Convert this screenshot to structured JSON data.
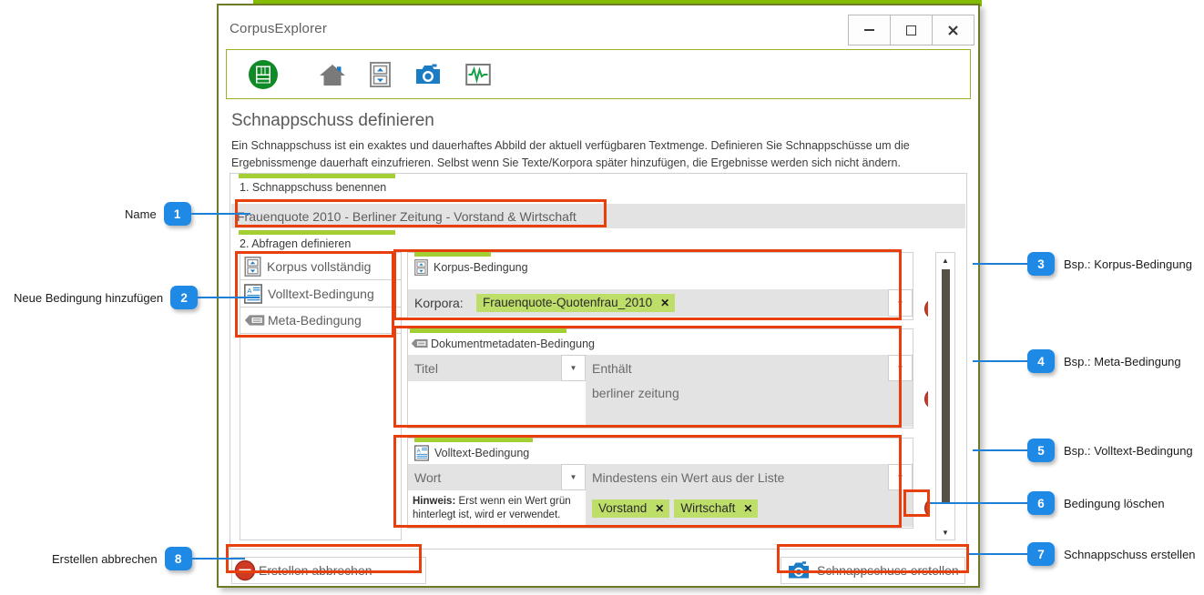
{
  "window": {
    "title": "CorpusExplorer",
    "controls": [
      {
        "name": "minimize",
        "glyph": "–"
      },
      {
        "name": "maximize",
        "glyph": "□"
      },
      {
        "name": "close",
        "glyph": "✕"
      }
    ]
  },
  "toolbar": {
    "icons": [
      {
        "name": "corpusexplorer-logo-icon",
        "label": "CorpusExplorer"
      },
      {
        "name": "home-icon",
        "label": "Start"
      },
      {
        "name": "archive-cabinet-icon",
        "label": "Korpora"
      },
      {
        "name": "camera-snapshot-icon",
        "label": "Schnappschuss"
      },
      {
        "name": "analytics-chart-icon",
        "label": "Analyse"
      }
    ]
  },
  "page": {
    "heading": "Schnappschuss definieren",
    "intro": "Ein Schnappschuss ist ein exaktes und dauerhaftes Abbild der aktuell verfügbaren Textmenge. Definieren Sie Schnappschüsse um die Ergebnissmenge dauerhaft einzufrieren. Selbst wenn Sie Texte/Korpora später hinzufügen, die Ergebnisse werden sich nicht ändern."
  },
  "step1": {
    "label": "1. Schnappschuss benennen",
    "name_value": "Frauenquote 2010 - Berliner Zeitung - Vorstand & Wirtschaft"
  },
  "step2": {
    "label": "2. Abfragen definieren",
    "condition_types": [
      {
        "icon": "archive-cabinet-icon",
        "label": "Korpus vollständig"
      },
      {
        "icon": "fulltext-document-icon",
        "label": "Volltext-Bedingung"
      },
      {
        "icon": "meta-tag-icon",
        "label": "Meta-Bedingung"
      }
    ]
  },
  "panels": [
    {
      "title": "Korpus-Bedingung",
      "icon": "archive-cabinet-icon",
      "field_label": "Korpora:",
      "tags": [
        {
          "text": "Frauenquote-Quotenfrau_2010",
          "remove": "✕"
        }
      ],
      "dropdown_glyph": "▼",
      "remove_glyph": "minus"
    },
    {
      "title": "Dokumentmetadaten-Bedingung",
      "icon": "meta-tag-icon",
      "left_select": "Titel",
      "right_select": "Enthält",
      "value_text": "berliner zeitung",
      "dropdown_glyph": "▼"
    },
    {
      "title": "Volltext-Bedingung",
      "icon": "fulltext-document-icon",
      "left_select": "Wort",
      "right_select": "Mindestens ein Wert aus der Liste",
      "hint_strong": "Hinweis:",
      "hint_text": " Erst wenn ein Wert grün hinterlegt ist, wird er verwendet.",
      "tags": [
        {
          "text": "Vorstand",
          "remove": "✕"
        },
        {
          "text": "Wirtschaft",
          "remove": "✕"
        }
      ],
      "dropdown_glyph": "▼"
    }
  ],
  "scrollbar": {
    "up_glyph": "▲",
    "down_glyph": "▼"
  },
  "actions": {
    "cancel_label": "Erstellen abbrechen",
    "cancel_icon": "cancel-minus-icon",
    "create_label": "Schnappschuss erstellen",
    "create_icon": "camera-snapshot-icon"
  },
  "annotations": [
    {
      "number": "1",
      "text": "Name",
      "side": "left"
    },
    {
      "number": "2",
      "text": "Neue Bedingung hinzufügen",
      "side": "left"
    },
    {
      "number": "3",
      "text": "Bsp.: Korpus-Bedingung",
      "side": "right"
    },
    {
      "number": "4",
      "text": "Bsp.: Meta-Bedingung",
      "side": "right"
    },
    {
      "number": "5",
      "text": "Bsp.: Volltext-Bedingung",
      "side": "right"
    },
    {
      "number": "6",
      "text": "Bedingung löschen",
      "side": "right"
    },
    {
      "number": "7",
      "text": "Schnappschuss erstellen",
      "side": "right"
    },
    {
      "number": "8",
      "text": "Erstellen abbrechen",
      "side": "left"
    }
  ],
  "colors": {
    "accent_green": "#84bd00",
    "section_green": "#a3cf35",
    "tag_green": "#bede6a",
    "highlight_red": "#e8400c",
    "badge_blue": "#1e8ae6",
    "remove_red": "#cf3a24"
  }
}
